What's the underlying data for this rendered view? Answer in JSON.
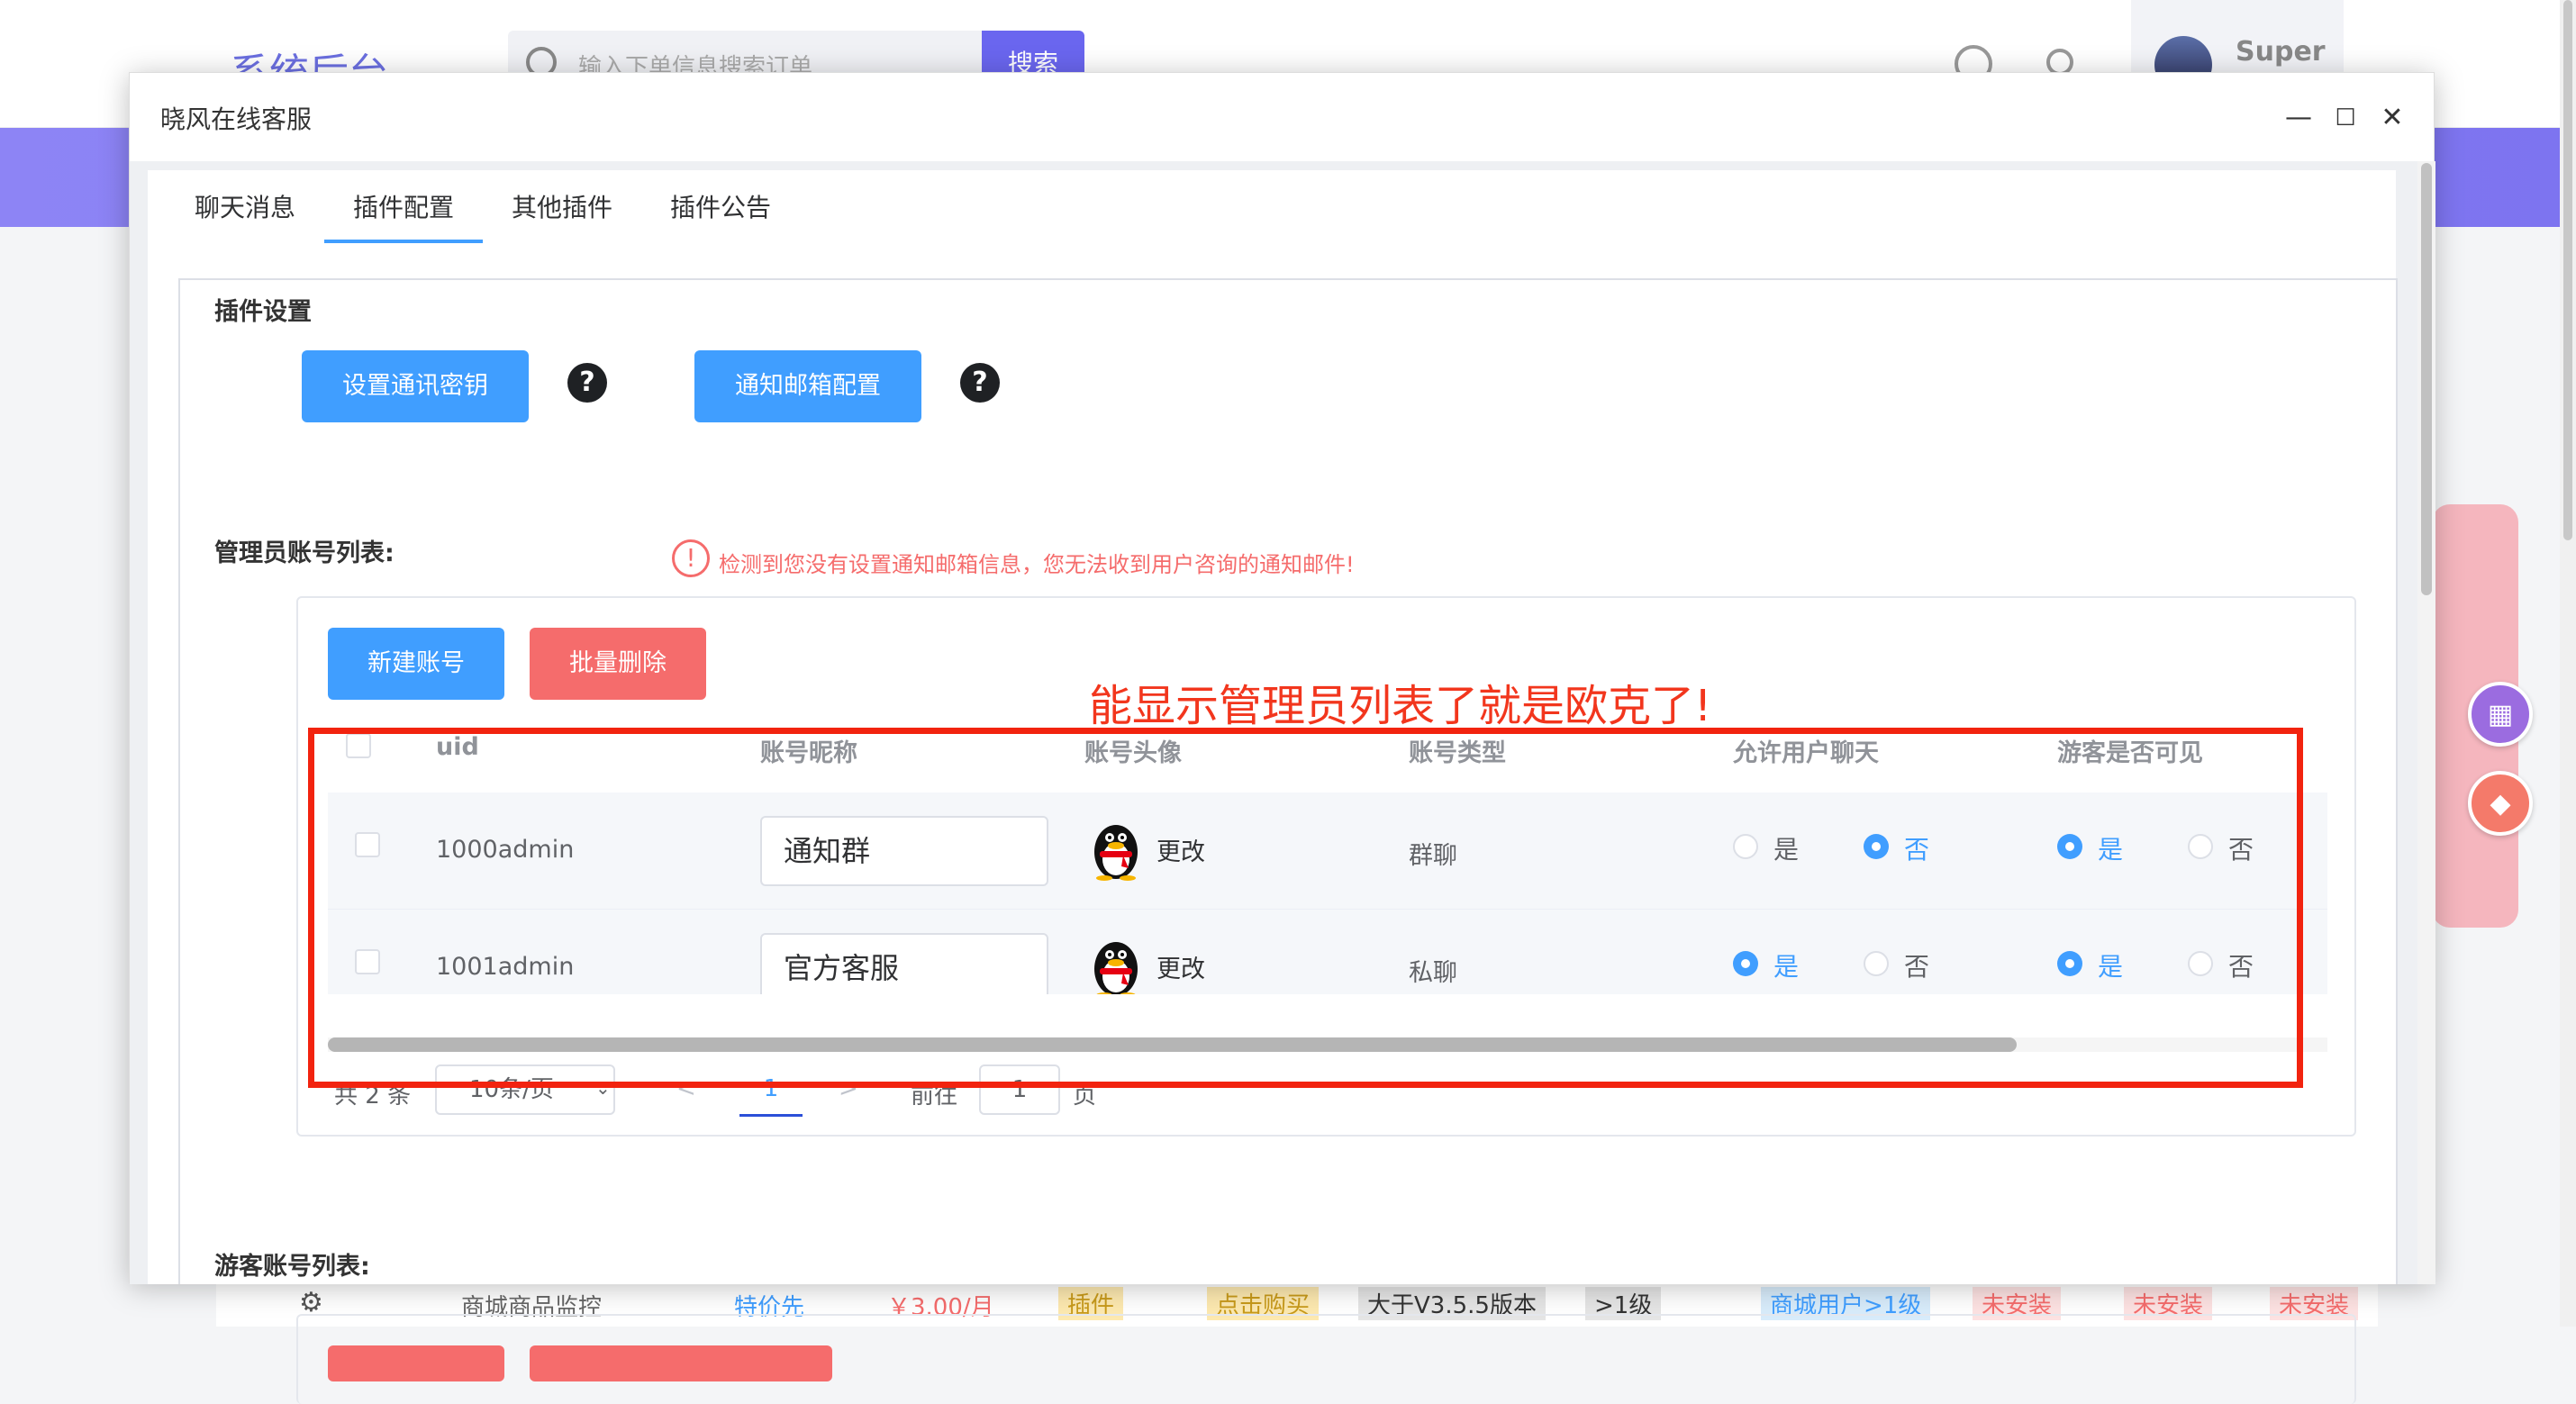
{
  "background": {
    "logo": "系统后台",
    "search_placeholder": "输入下单信息搜索订单",
    "search_button": "搜索",
    "user_name": "Super",
    "bottom_row": [
      "商城商品监控",
      "特价先",
      "￥3.00/月",
      "插件",
      "点击购买",
      "大于V3.5.5版本",
      ">1级",
      "商城用户>1级",
      "未安装",
      "未安装",
      "未安装"
    ]
  },
  "dialog": {
    "title": "晓风在线客服",
    "controls": {
      "minimize": "—",
      "maximize": "☐",
      "close": "✕"
    },
    "tabs": [
      {
        "label": "聊天消息",
        "active": false
      },
      {
        "label": "插件配置",
        "active": true
      },
      {
        "label": "其他插件",
        "active": false
      },
      {
        "label": "插件公告",
        "active": false
      }
    ],
    "plugin_settings": {
      "title": "插件设置",
      "set_key_button": "设置通讯密钥",
      "mail_config_button": "通知邮箱配置",
      "help": "?",
      "warning_icon": "!",
      "warning": "检测到您没有设置通知邮箱信息，您无法收到用户咨询的通知邮件!"
    },
    "admin_list": {
      "title": "管理员账号列表:",
      "new_button": "新建账号",
      "batch_delete_button": "批量删除",
      "annotation": "能显示管理员列表了就是欧克了!",
      "columns": [
        "uid",
        "账号昵称",
        "账号头像",
        "账号类型",
        "允许用户聊天",
        "游客是否可见"
      ],
      "change_label": "更改",
      "yes": "是",
      "no": "否",
      "rows": [
        {
          "uid": "1000admin",
          "nickname": "通知群",
          "type": "群聊",
          "allow_chat": false,
          "guest_visible": true
        },
        {
          "uid": "1001admin",
          "nickname": "官方客服",
          "type": "私聊",
          "allow_chat": true,
          "guest_visible": true
        }
      ],
      "pagination": {
        "total": "共 2 条",
        "page_size": "10条/页",
        "prev": "<",
        "current_page": "1",
        "next": ">",
        "goto_label": "前往",
        "goto_value": "1",
        "page_suffix": "页"
      }
    },
    "guest_list": {
      "title": "游客账号列表:"
    }
  },
  "colors": {
    "primary": "#409eff",
    "danger": "#f56c6c",
    "annotation": "#f2230f",
    "band": "#8d84f5"
  }
}
